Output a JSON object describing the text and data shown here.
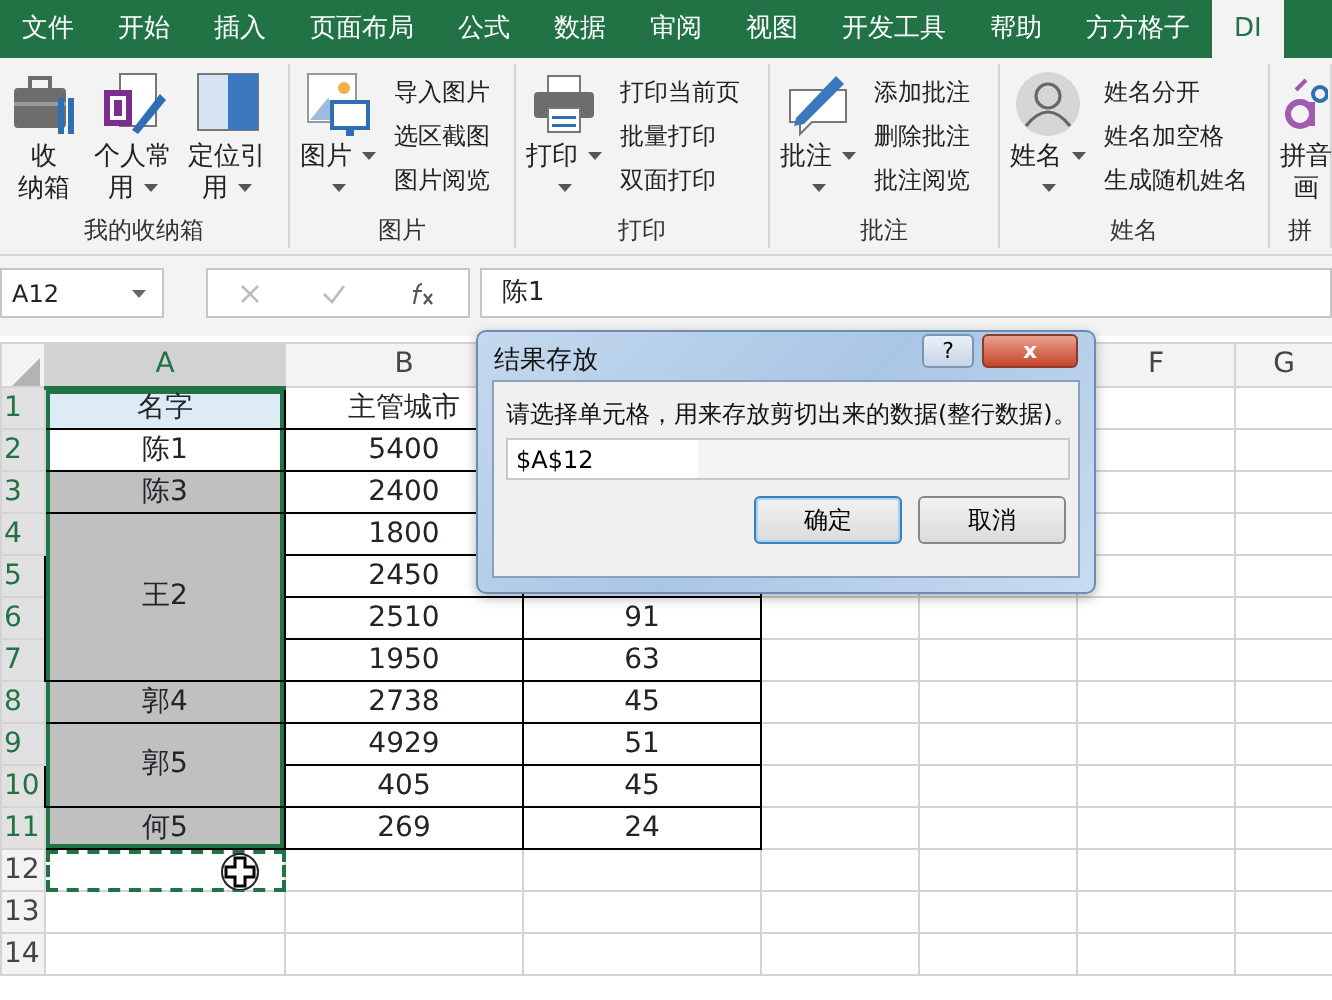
{
  "tabs": [
    {
      "label": "文件",
      "selected": false
    },
    {
      "label": "开始",
      "selected": false
    },
    {
      "label": "插入",
      "selected": false
    },
    {
      "label": "页面布局",
      "selected": false
    },
    {
      "label": "公式",
      "selected": false
    },
    {
      "label": "数据",
      "selected": false
    },
    {
      "label": "审阅",
      "selected": false
    },
    {
      "label": "视图",
      "selected": false
    },
    {
      "label": "开发工具",
      "selected": false
    },
    {
      "label": "帮助",
      "selected": false
    },
    {
      "label": "方方格子",
      "selected": false
    },
    {
      "label": "DI",
      "selected": true
    }
  ],
  "ribbon_groups": [
    {
      "label": "我的收纳箱",
      "large_buttons": [
        {
          "lines": [
            "收",
            "纳箱"
          ],
          "dropdown": false
        },
        {
          "lines": [
            "个人常",
            "用"
          ],
          "dropdown": true
        },
        {
          "lines": [
            "定位引",
            "用"
          ],
          "dropdown": true
        }
      ]
    },
    {
      "label": "图片",
      "large_buttons": [
        {
          "lines": [
            "图片"
          ],
          "dropdown": true
        }
      ],
      "small_buttons": [
        "导入图片",
        "选区截图",
        "图片阅览"
      ]
    },
    {
      "label": "打印",
      "large_buttons": [
        {
          "lines": [
            "打印"
          ],
          "dropdown": true
        }
      ],
      "small_buttons": [
        "打印当前页",
        "批量打印",
        "双面打印"
      ]
    },
    {
      "label": "批注",
      "large_buttons": [
        {
          "lines": [
            "批注"
          ],
          "dropdown": true
        }
      ],
      "small_buttons": [
        "添加批注",
        "删除批注",
        "批注阅览"
      ]
    },
    {
      "label": "姓名",
      "large_buttons": [
        {
          "lines": [
            "姓名"
          ],
          "dropdown": true
        }
      ],
      "small_buttons": [
        "姓名分开",
        "姓名加空格",
        "生成随机姓名"
      ]
    },
    {
      "label": "拼",
      "large_buttons": [
        {
          "lines": [
            "拼音",
            "画"
          ],
          "dropdown": false
        }
      ]
    }
  ],
  "name_box": "A12",
  "formula": "陈1",
  "column_headers": [
    {
      "label": "A",
      "selected": true
    },
    {
      "label": "B",
      "selected": false
    },
    {
      "label": "F",
      "selected": false
    },
    {
      "label": "G",
      "selected": false
    }
  ],
  "rows": [
    {
      "number": "1",
      "selected": true,
      "cells": [
        {
          "text": "名字",
          "color": "#ddebf7",
          "selected": true
        },
        {
          "text": "主管城市",
          "selected": false
        }
      ]
    },
    {
      "number": "2",
      "selected": true,
      "cells": [
        {
          "text": "陈1",
          "selected": true
        },
        {
          "text": "5400",
          "selected": false
        }
      ]
    },
    {
      "number": "3",
      "selected": true,
      "cells": [
        {
          "text": "陈3",
          "color": "#c0c0c0",
          "selected": true
        },
        {
          "text": "2400",
          "selected": false
        }
      ]
    },
    {
      "number": "4",
      "selected": true,
      "cells": [
        {
          "text": "王2",
          "color": "#c0c0c0",
          "selected": true
        },
        {
          "text": "1800",
          "selected": false
        }
      ]
    },
    {
      "number": "5",
      "selected": true,
      "cells": [
        {
          "kind": "merged"
        },
        {
          "text": "2450",
          "selected": false
        }
      ]
    },
    {
      "number": "6",
      "selected": true,
      "cells": [
        {
          "kind": "merged"
        },
        {
          "text": "2510",
          "selected": false
        },
        {
          "text": "91",
          "selected": false
        }
      ]
    },
    {
      "number": "7",
      "selected": true,
      "cells": [
        {
          "kind": "merged"
        },
        {
          "text": "1950",
          "selected": false
        },
        {
          "text": "63",
          "selected": false
        }
      ]
    },
    {
      "number": "8",
      "selected": true,
      "cells": [
        {
          "text": "郭4",
          "color": "#c0c0c0",
          "selected": true
        },
        {
          "text": "2738",
          "selected": false
        },
        {
          "text": "45",
          "selected": false
        }
      ]
    },
    {
      "number": "9",
      "selected": true,
      "cells": [
        {
          "text": "郭5",
          "color": "#c0c0c0",
          "selected": true
        },
        {
          "text": "4929",
          "selected": false
        },
        {
          "text": "51",
          "selected": false
        }
      ]
    },
    {
      "number": "10",
      "selected": true,
      "cells": [
        {
          "kind": "merged"
        },
        {
          "text": "405",
          "selected": false
        },
        {
          "text": "45",
          "selected": false
        }
      ]
    },
    {
      "number": "11",
      "selected": true,
      "cells": [
        {
          "text": "何5",
          "color": "#c0c0c0",
          "selected": true
        },
        {
          "text": "269",
          "selected": false
        },
        {
          "text": "24",
          "selected": false
        }
      ]
    },
    {
      "number": "12",
      "selected": false,
      "cells": [
        {
          "kind": "marquee"
        }
      ]
    },
    {
      "number": "13",
      "selected": false,
      "cells": []
    },
    {
      "number": "14",
      "selected": false,
      "cells": []
    }
  ],
  "dialog": {
    "title": "结果存放",
    "help": "?",
    "close": "x",
    "message": "请选择单元格，用来存放剪切出来的数据(整行数据)。",
    "value": "$A$12",
    "buttons": [
      {
        "label": "确定",
        "default": true
      },
      {
        "label": "取消",
        "default": false
      }
    ]
  }
}
